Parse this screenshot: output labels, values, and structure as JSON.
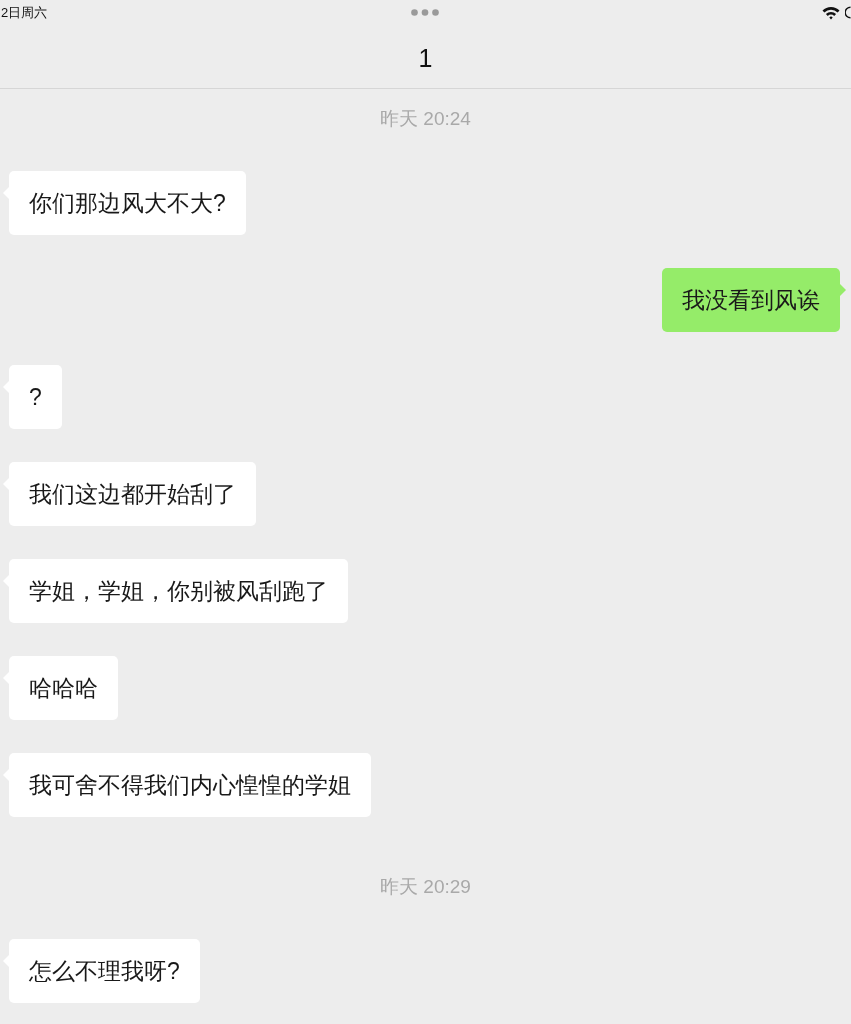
{
  "status_bar": {
    "date": "2日周六"
  },
  "header": {
    "title": "1"
  },
  "messages": [
    {
      "kind": "time",
      "text": "昨天 20:24"
    },
    {
      "kind": "incoming",
      "text": "你们那边风大不大?"
    },
    {
      "kind": "outgoing",
      "text": "我没看到风诶"
    },
    {
      "kind": "incoming",
      "text": "?"
    },
    {
      "kind": "incoming",
      "text": "我们这边都开始刮了"
    },
    {
      "kind": "incoming",
      "text": "学姐，学姐，你别被风刮跑了"
    },
    {
      "kind": "incoming",
      "text": "哈哈哈"
    },
    {
      "kind": "incoming",
      "text": "我可舍不得我们内心惶惶的学姐"
    },
    {
      "kind": "time",
      "text": "昨天 20:29"
    },
    {
      "kind": "incoming",
      "text": "怎么不理我呀?"
    }
  ]
}
